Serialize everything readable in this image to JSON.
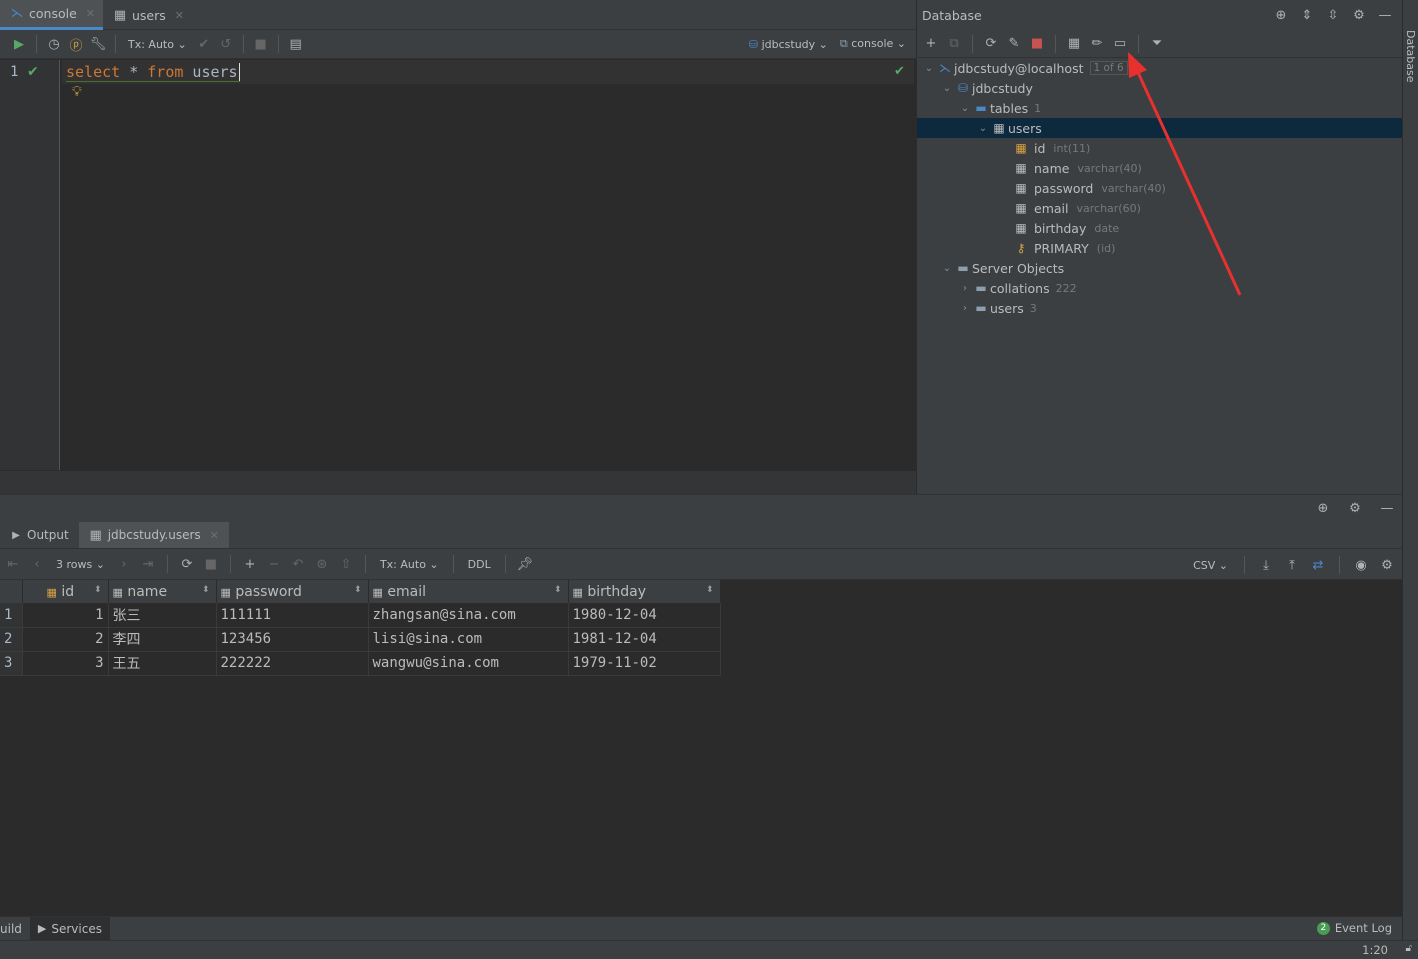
{
  "editor": {
    "tabs": [
      {
        "label": "console",
        "icon": "console-icon"
      },
      {
        "label": "users",
        "icon": "table-icon"
      }
    ],
    "toolbar": {
      "tx_label": "Tx: Auto",
      "schema_label": "jdbcstudy",
      "session_label": "console"
    },
    "line_number": "1",
    "code": {
      "kw1": "select",
      "star": " * ",
      "kw2": "from",
      "table": " users"
    }
  },
  "database": {
    "title": "Database",
    "tree": {
      "connection": "jdbcstudy@localhost",
      "connection_badge": "1 of 6",
      "schema": "jdbcstudy",
      "tables_label": "tables",
      "tables_count": "1",
      "table": "users",
      "columns": [
        {
          "name": "id",
          "type": "int(11)"
        },
        {
          "name": "name",
          "type": "varchar(40)"
        },
        {
          "name": "password",
          "type": "varchar(40)"
        },
        {
          "name": "email",
          "type": "varchar(60)"
        },
        {
          "name": "birthday",
          "type": "date"
        }
      ],
      "key": {
        "name": "PRIMARY",
        "type": "(id)"
      },
      "server_objects": "Server Objects",
      "collations": "collations",
      "collations_count": "222",
      "users_folder": "users",
      "users_count": "3"
    }
  },
  "right_strip_label": "Database",
  "services": {
    "tabs": [
      {
        "label": "Output"
      },
      {
        "label": "jdbcstudy.users"
      }
    ],
    "toolbar": {
      "rows_label": "3 rows",
      "tx_label": "Tx: Auto",
      "ddl_label": "DDL",
      "csv_label": "CSV"
    },
    "columns": [
      "id",
      "name",
      "password",
      "email",
      "birthday"
    ],
    "rows": [
      {
        "num": "1",
        "id": "1",
        "name": "张三",
        "password": "111111",
        "email": "zhangsan@sina.com",
        "birthday": "1980-12-04"
      },
      {
        "num": "2",
        "id": "2",
        "name": "李四",
        "password": "123456",
        "email": "lisi@sina.com",
        "birthday": "1981-12-04"
      },
      {
        "num": "3",
        "id": "3",
        "name": "王五",
        "password": "222222",
        "email": "wangwu@sina.com",
        "birthday": "1979-11-02"
      }
    ]
  },
  "bottom": {
    "build_label": "uild",
    "services_label": "Services",
    "event_count": "2",
    "event_log": "Event Log",
    "caret": "1:20"
  },
  "colors": {
    "accent": "#4a88c7",
    "keyword": "#cc7832",
    "annotation": "#e8312f",
    "selection": "#0d293e"
  }
}
